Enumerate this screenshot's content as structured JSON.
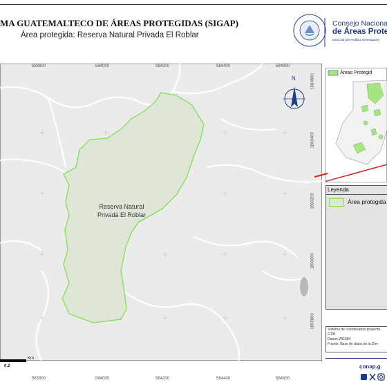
{
  "header": {
    "title": "MA GUATEMALTECO DE ÁREAS PROTEGIDAS  (SIGAP)",
    "subtitle": "Área protegida: Reserva Natural Privada El Roblar"
  },
  "logos": {
    "seal_text_top": "GOBIERNO DE LA REPÚBLICA",
    "seal_text_bottom": "GUATEMALA",
    "conap_line1": "Consejo Nacional",
    "conap_line2": "de Áreas Protegi",
    "conap_line3": "Dirección de Análisis Geoespacial"
  },
  "map": {
    "x_ticks": [
      "583800",
      "584000",
      "584200",
      "584400",
      "584600"
    ],
    "y_ticks": [
      "1660600",
      "1660400",
      "1660200",
      "1660000",
      "1659800"
    ],
    "area_label_line1": "Reserva Natural",
    "area_label_line2": "Privada El Roblar",
    "north_label": "N",
    "scale_unit": "Km",
    "scale_value": "0.2",
    "colors": {
      "area_fill": "#dfe6d8",
      "area_stroke": "#7ee04e",
      "background": "#ebebeb",
      "roads": "#ffffff"
    }
  },
  "inset": {
    "legend_label": "Áreas Protegid",
    "colors": {
      "protected": "#a6e682",
      "land": "#f2f2f2",
      "sea": "#ffffff",
      "pointer": "#d62020"
    }
  },
  "legend": {
    "title": "Leyenda",
    "item_label": "Área protegida"
  },
  "metadata": {
    "line1": "Sistema de coordenadas proyecta",
    "line2": "GTM",
    "line3": "Datum WGS84",
    "line4": "Fuente: Base de datos de la Dire"
  },
  "footer": {
    "url": "conap.g",
    "social_icons": [
      "facebook-icon",
      "x-icon",
      "instagram-icon"
    ]
  }
}
